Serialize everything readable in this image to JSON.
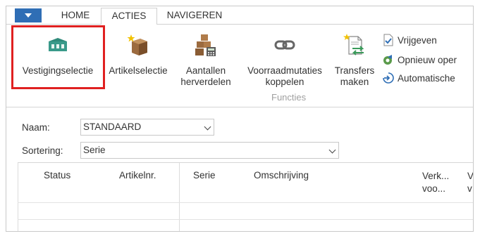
{
  "tabs": [
    "HOME",
    "ACTIES",
    "NAVIGEREN"
  ],
  "ribbon": {
    "buttons": [
      {
        "label": "Vestigingselectie",
        "icon": "warehouse-icon"
      },
      {
        "label": "Artikelselectie",
        "icon": "box-star-icon"
      },
      {
        "label_line1": "Aantallen",
        "label_line2": "herverdelen",
        "icon": "boxes-calculator-icon"
      },
      {
        "label_line1": "Voorraadmutaties",
        "label_line2": "koppelen",
        "icon": "link-icon"
      },
      {
        "label_line1": "Transfers",
        "label_line2": "maken",
        "icon": "document-transfer-icon"
      }
    ],
    "small_buttons": [
      {
        "label": "Vrijgeven",
        "icon": "release-document-icon"
      },
      {
        "label": "Opnieuw oper",
        "icon": "reopen-icon"
      },
      {
        "label": "Automatische",
        "icon": "automatic-icon"
      }
    ],
    "group_label": "Functies"
  },
  "filters": {
    "naam_label": "Naam:",
    "naam_value": "STANDAARD",
    "sortering_label": "Sortering:",
    "sortering_value": "Serie"
  },
  "grid": {
    "columns": [
      "Status",
      "Artikelnr.",
      "Serie",
      "Omschrijving"
    ],
    "col5_line1": "Verk...",
    "col5_line2": "voo...",
    "col6_line1": "V",
    "col6_line2": "v"
  },
  "colors": {
    "accent": "#2f6eb5",
    "highlight": "#e02020",
    "teal": "#3a9a8a"
  }
}
